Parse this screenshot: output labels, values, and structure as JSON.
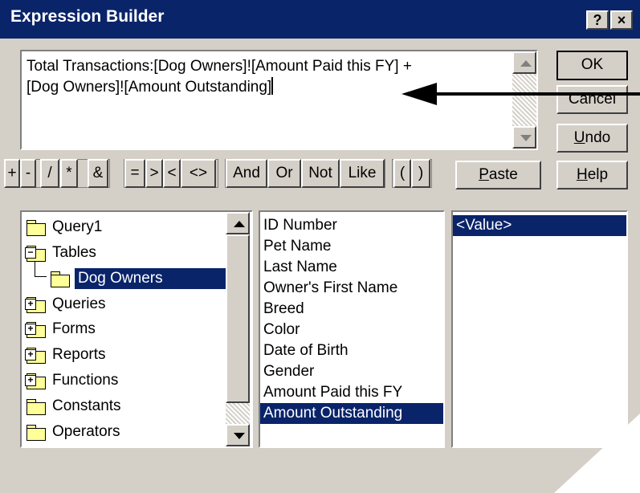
{
  "window": {
    "title": "Expression Builder",
    "help_glyph": "?",
    "close_glyph": "×"
  },
  "expression": {
    "line1": "Total Transactions:[Dog Owners]![Amount Paid this FY] +",
    "line2": "[Dog Owners]![Amount Outstanding]"
  },
  "buttons": {
    "ok": "OK",
    "cancel": "Cancel",
    "undo_key": "U",
    "undo_rest": "ndo",
    "paste_key": "P",
    "paste_rest": "aste",
    "help_key": "H",
    "help_rest": "elp"
  },
  "operators": [
    "+",
    "-",
    "/",
    "*",
    "&",
    "=",
    ">",
    "<",
    "<>",
    "And",
    "Or",
    "Not",
    "Like",
    "(",
    ")"
  ],
  "tree": {
    "items": [
      {
        "label": "Query1",
        "icon": "folder-icon"
      },
      {
        "label": "Tables",
        "icon": "folder-open-icon",
        "toggle": "−"
      },
      {
        "label": "Dog Owners",
        "icon": "folder-open-icon",
        "selected": true
      },
      {
        "label": "Queries",
        "icon": "folder-icon",
        "toggle": "+"
      },
      {
        "label": "Forms",
        "icon": "folder-icon",
        "toggle": "+"
      },
      {
        "label": "Reports",
        "icon": "folder-icon",
        "toggle": "+"
      },
      {
        "label": "Functions",
        "icon": "folder-icon",
        "toggle": "+"
      },
      {
        "label": "Constants",
        "icon": "folder-icon"
      },
      {
        "label": "Operators",
        "icon": "folder-icon"
      }
    ]
  },
  "fields": {
    "items": [
      "ID Number",
      "Pet Name",
      "Last Name",
      "Owner's First Name",
      "Breed",
      "Color",
      "Date of Birth",
      "Gender",
      "Amount Paid this FY",
      "Amount Outstanding"
    ],
    "selected": "Amount Outstanding"
  },
  "values": {
    "items": [
      "<Value>"
    ],
    "selected": "<Value>"
  },
  "colors": {
    "title_bar": "#0a246a",
    "face": "#d4d0c8",
    "selection": "#0a246a"
  }
}
